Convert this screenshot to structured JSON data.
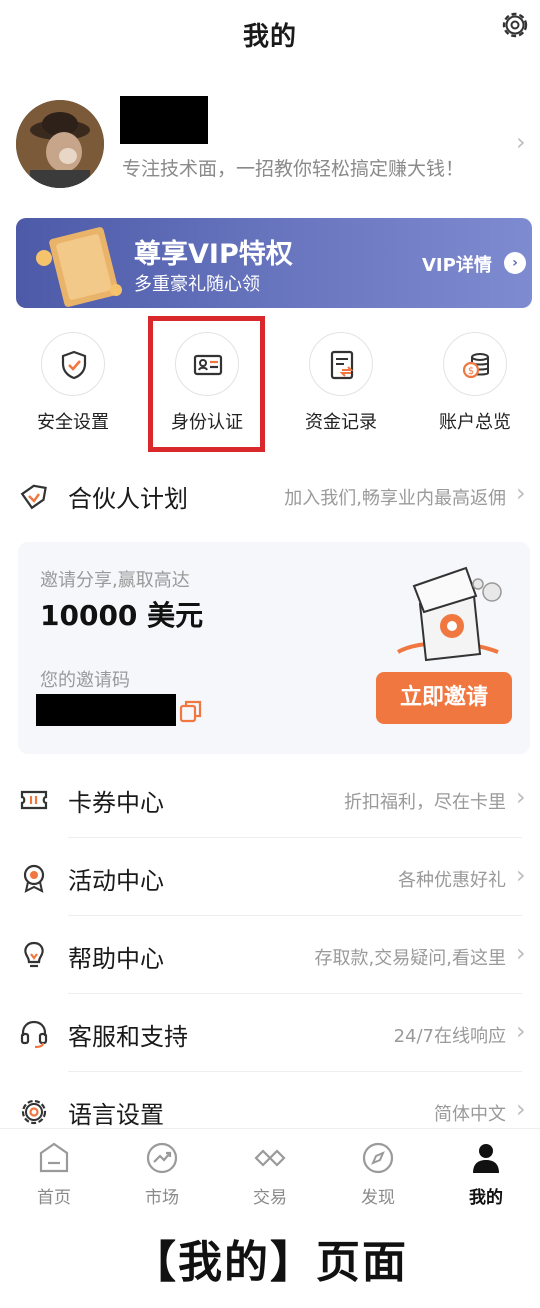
{
  "header": {
    "title": "我的"
  },
  "profile": {
    "tagline": "专注技术面，一招教你轻松搞定赚大钱！"
  },
  "vip_banner": {
    "title": "尊享VIP特权",
    "subtitle": "多重豪礼随心领",
    "detail_label": "VIP详情"
  },
  "quick_actions": [
    {
      "label": "安全设置",
      "icon": "shield-check-icon"
    },
    {
      "label": "身份认证",
      "icon": "id-card-icon"
    },
    {
      "label": "资金记录",
      "icon": "fund-record-icon"
    },
    {
      "label": "账户总览",
      "icon": "coin-stack-icon"
    }
  ],
  "partner": {
    "title": "合伙人计划",
    "subtitle": "加入我们,畅享业内最高返佣",
    "icon": "diamond-tag-icon"
  },
  "invite": {
    "label": "邀请分享,赢取高达",
    "amount": "10000 美元",
    "code_label": "您的邀请码",
    "button_label": "立即邀请"
  },
  "menu": [
    {
      "title": "卡券中心",
      "subtitle": "折扣福利，尽在卡里",
      "icon": "coupon-icon"
    },
    {
      "title": "活动中心",
      "subtitle": "各种优惠好礼",
      "icon": "medal-icon"
    },
    {
      "title": "帮助中心",
      "subtitle": "存取款,交易疑问,看这里",
      "icon": "lightbulb-icon"
    },
    {
      "title": "客服和支持",
      "subtitle": "24/7在线响应",
      "icon": "headset-icon"
    },
    {
      "title": "语言设置",
      "subtitle": "简体中文",
      "icon": "settings-icon"
    }
  ],
  "tabs": [
    {
      "label": "首页",
      "icon": "home-icon",
      "active": false
    },
    {
      "label": "市场",
      "icon": "market-trend-icon",
      "active": false
    },
    {
      "label": "交易",
      "icon": "trade-icon",
      "active": false
    },
    {
      "label": "发现",
      "icon": "compass-icon",
      "active": false
    },
    {
      "label": "我的",
      "icon": "person-icon",
      "active": true
    }
  ],
  "caption": "【我的】页面",
  "colors": {
    "accent_orange": "#f07840",
    "vip_blue": "#5e6ab5",
    "highlight_red": "#d9282c"
  }
}
